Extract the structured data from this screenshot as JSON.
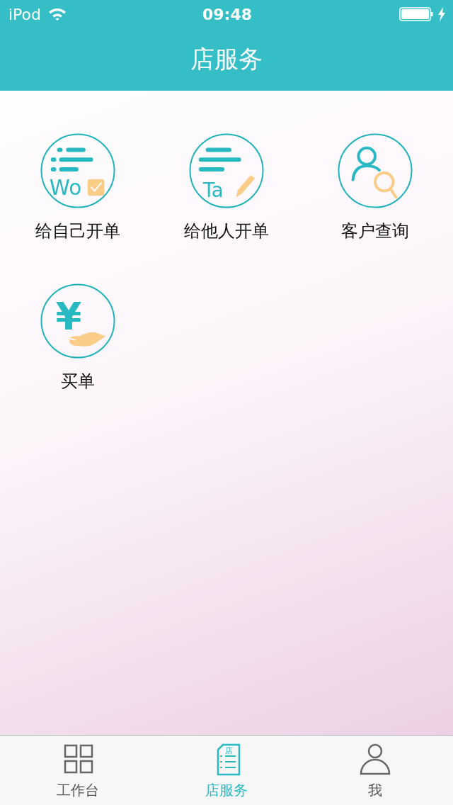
{
  "status_bar": {
    "carrier": "iPod",
    "time": "09:48"
  },
  "nav_bar": {
    "title": "店服务"
  },
  "services": [
    {
      "kind": "self_order",
      "icon_text": "Wo",
      "label": "给自己开单"
    },
    {
      "kind": "other_order",
      "icon_text": "Ta",
      "label": "给他人开单"
    },
    {
      "kind": "customer_search",
      "label": "客户查询"
    },
    {
      "kind": "payment",
      "icon_text": "¥",
      "label": "买单"
    }
  ],
  "tabs": [
    {
      "kind": "grid",
      "label": "工作台",
      "selected": false
    },
    {
      "kind": "store_list",
      "icon_text": "店",
      "label": "店服务",
      "selected": true
    },
    {
      "kind": "person",
      "label": "我",
      "selected": false
    }
  ]
}
